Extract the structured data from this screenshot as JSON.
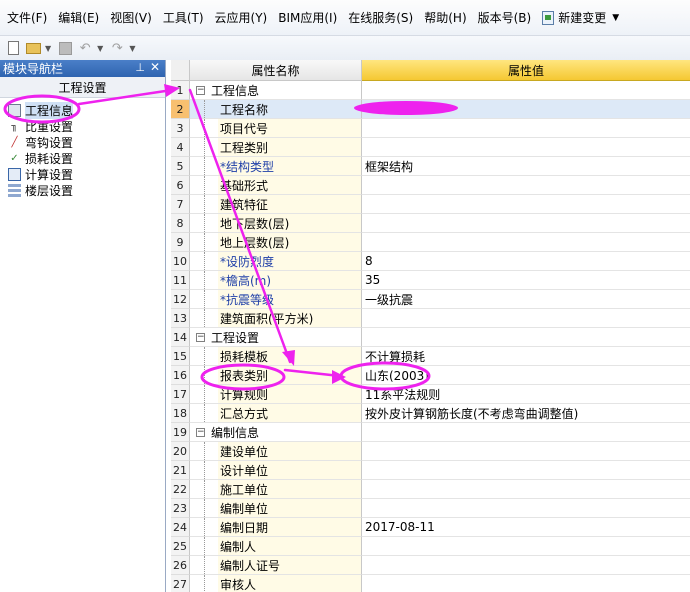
{
  "menubar": {
    "items": [
      "文件(F)",
      "编辑(E)",
      "视图(V)",
      "工具(T)",
      "云应用(Y)",
      "BIM应用(I)",
      "在线服务(S)",
      "帮助(H)",
      "版本号(B)"
    ],
    "new_change": "新建变更"
  },
  "left_panel": {
    "title": "模块导航栏",
    "header": "工程设置",
    "items": [
      {
        "label": "工程信息",
        "icon": "info-icon"
      },
      {
        "label": "比重设置",
        "icon": "anchor-icon"
      },
      {
        "label": "弯钩设置",
        "icon": "hook-icon"
      },
      {
        "label": "损耗设置",
        "icon": "loss-icon"
      },
      {
        "label": "计算设置",
        "icon": "calc-icon"
      },
      {
        "label": "楼层设置",
        "icon": "floor-icon"
      }
    ]
  },
  "grid": {
    "col_name": "属性名称",
    "col_value": "属性值",
    "rows": [
      {
        "num": "1",
        "name": "工程信息",
        "value": "",
        "group": true
      },
      {
        "num": "2",
        "name": "工程名称",
        "value": "",
        "current": true
      },
      {
        "num": "3",
        "name": "项目代号",
        "value": ""
      },
      {
        "num": "4",
        "name": "工程类别",
        "value": ""
      },
      {
        "num": "5",
        "name": "*结构类型",
        "value": "框架结构",
        "required": true
      },
      {
        "num": "6",
        "name": "基础形式",
        "value": ""
      },
      {
        "num": "7",
        "name": "建筑特征",
        "value": ""
      },
      {
        "num": "8",
        "name": "地下层数(层)",
        "value": ""
      },
      {
        "num": "9",
        "name": "地上层数(层)",
        "value": ""
      },
      {
        "num": "10",
        "name": "*设防烈度",
        "value": "8",
        "required": true
      },
      {
        "num": "11",
        "name": "*檐高(m)",
        "value": "35",
        "required": true
      },
      {
        "num": "12",
        "name": "*抗震等级",
        "value": "一级抗震",
        "required": true
      },
      {
        "num": "13",
        "name": "建筑面积(平方米)",
        "value": ""
      },
      {
        "num": "14",
        "name": "工程设置",
        "value": "",
        "group": true
      },
      {
        "num": "15",
        "name": "损耗模板",
        "value": "不计算损耗"
      },
      {
        "num": "16",
        "name": "报表类别",
        "value": "山东(2003)"
      },
      {
        "num": "17",
        "name": "计算规则",
        "value": "11系平法规则"
      },
      {
        "num": "18",
        "name": "汇总方式",
        "value": "按外皮计算钢筋长度(不考虑弯曲调整值)"
      },
      {
        "num": "19",
        "name": "编制信息",
        "value": "",
        "group": true
      },
      {
        "num": "20",
        "name": "建设单位",
        "value": ""
      },
      {
        "num": "21",
        "name": "设计单位",
        "value": ""
      },
      {
        "num": "22",
        "name": "施工单位",
        "value": ""
      },
      {
        "num": "23",
        "name": "编制单位",
        "value": ""
      },
      {
        "num": "24",
        "name": "编制日期",
        "value": "2017-08-11"
      },
      {
        "num": "25",
        "name": "编制人",
        "value": ""
      },
      {
        "num": "26",
        "name": "编制人证号",
        "value": ""
      },
      {
        "num": "27",
        "name": "审核人",
        "value": ""
      }
    ]
  },
  "colors": {
    "annotation": "#ee22ee",
    "value_header": "#f5c832",
    "panel_title": "#2f64b0",
    "current_row": "#dde9f7"
  }
}
